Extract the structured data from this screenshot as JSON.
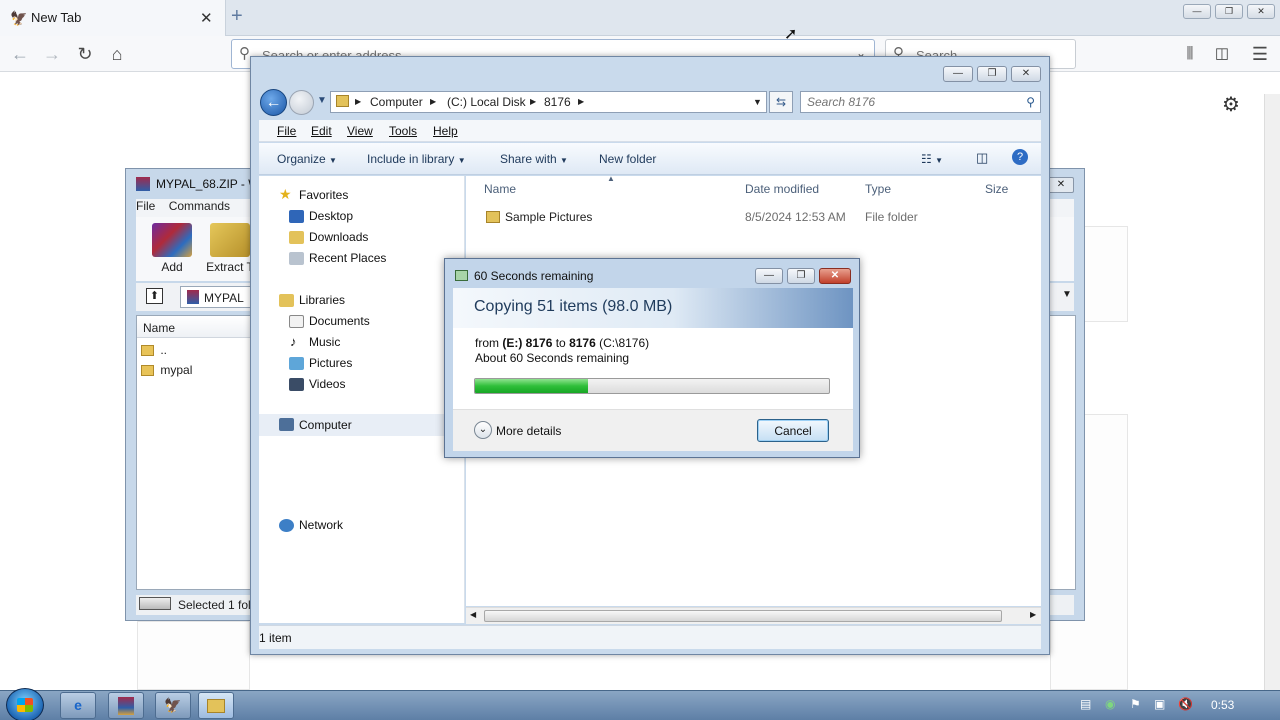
{
  "browser": {
    "tab_title": "New Tab",
    "tab_close": "✕",
    "new_tab": "+",
    "url_placeholder": "Search or enter address",
    "search_placeholder": "Search",
    "window_min": "—",
    "window_restore": "❐",
    "window_close": "✕"
  },
  "winrar": {
    "title": "MYPAL_68.ZIP - W",
    "menu": [
      "File",
      "Commands"
    ],
    "tools": [
      "Add",
      "Extract T"
    ],
    "path_label": "MYPAL",
    "list_header": "Name",
    "rows": [
      "..",
      "mypal"
    ],
    "status": "Selected 1 fol"
  },
  "explorer": {
    "breadcrumb": [
      "Computer",
      "(C:) Local Disk",
      "8176"
    ],
    "search_placeholder": "Search 8176",
    "menu": [
      "File",
      "Edit",
      "View",
      "Tools",
      "Help"
    ],
    "commands": [
      "Organize",
      "Include in library",
      "Share with",
      "New folder"
    ],
    "favorites_header": "Favorites",
    "favorites": [
      "Desktop",
      "Downloads",
      "Recent Places"
    ],
    "libraries_header": "Libraries",
    "libraries": [
      "Documents",
      "Music",
      "Pictures",
      "Videos"
    ],
    "computer": "Computer",
    "network": "Network",
    "columns": [
      "Name",
      "Date modified",
      "Type",
      "Size"
    ],
    "files": [
      {
        "name": "Sample Pictures",
        "date": "8/5/2024 12:53 AM",
        "type": "File folder",
        "size": ""
      }
    ],
    "status": "1 item"
  },
  "copy_dialog": {
    "title": "60 Seconds remaining",
    "heading": "Copying 51 items (98.0 MB)",
    "from_prefix": "from",
    "source": "(E:) 8176",
    "to_word": "to",
    "destination": "8176",
    "destination_path": "(C:\\8176)",
    "remaining": "About 60 Seconds remaining",
    "progress": 0.32,
    "more_details": "More details",
    "cancel": "Cancel"
  },
  "taskbar": {
    "clock": "0:53"
  },
  "colors": {
    "progress_green": "#2fbf3a",
    "explorer_frame": "#c9daec",
    "taskbar": "#6f8fb3"
  }
}
